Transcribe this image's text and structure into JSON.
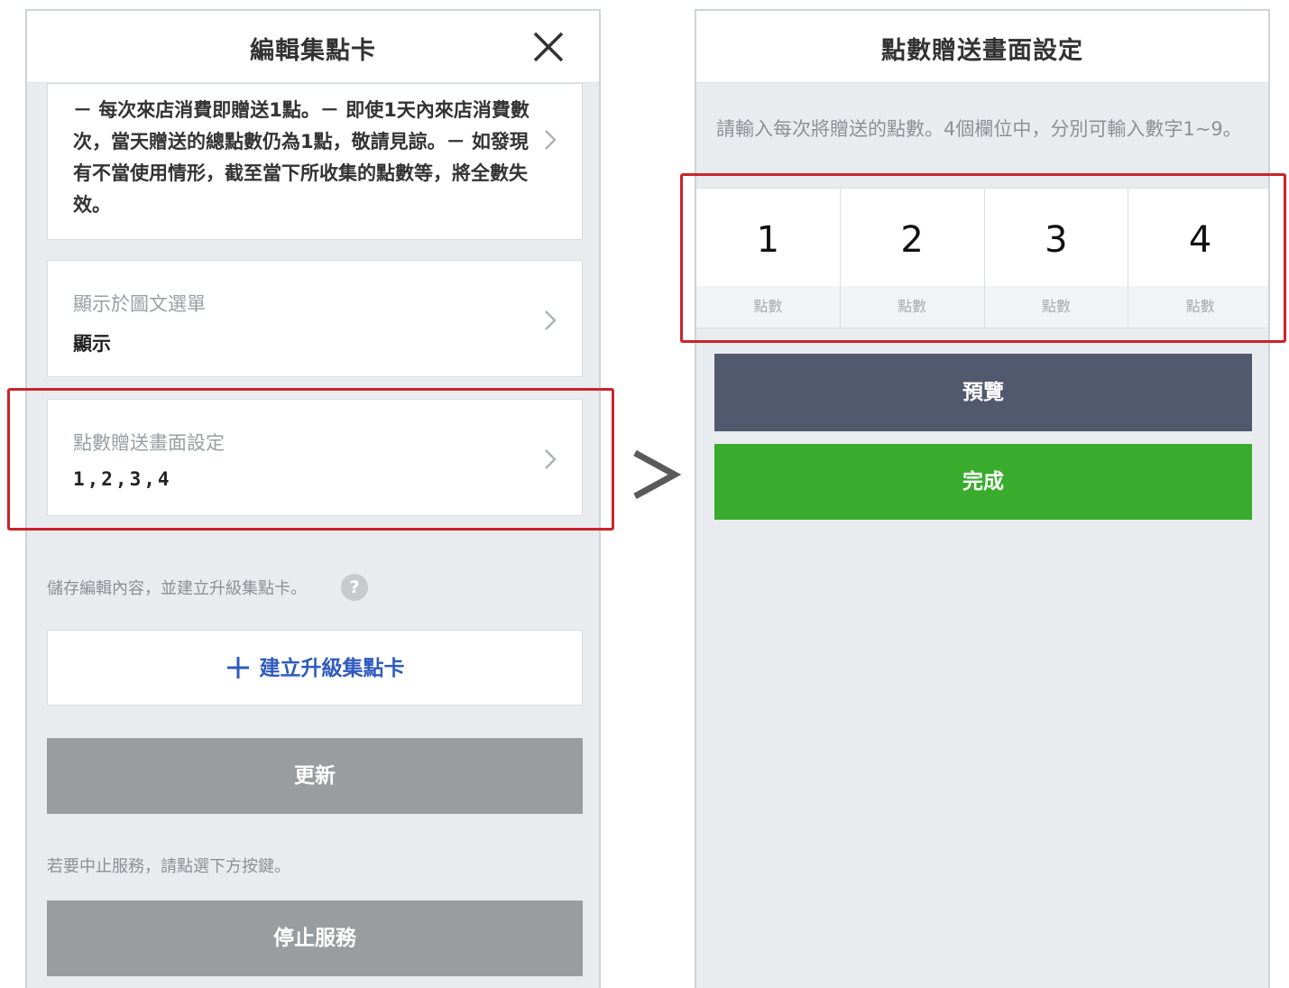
{
  "left": {
    "title": "編輯集點卡",
    "rules_text": "－ 每次來店消費即贈送1點。－ 即使1天內來店消費數次，當天贈送的總點數仍為1點，敬請見諒。－ 如發現有不當使用情形，截至當下所收集的點數等，將全數失效。",
    "rich_menu": {
      "label": "顯示於圖文選單",
      "value": "顯示"
    },
    "points_setting": {
      "label": "點數贈送畫面設定",
      "value": "1,2,3,4"
    },
    "save_hint": "儲存編輯內容，並建立升級集點卡。",
    "help_icon_text": "?",
    "create_upgrade_label": "建立升級集點卡",
    "update_label": "更新",
    "stop_hint": "若要中止服務，請點選下方按鍵。",
    "stop_label": "停止服務"
  },
  "right": {
    "title": "點數贈送畫面設定",
    "instruction": "請輸入每次將贈送的點數。4個欄位中，分別可輸入數字1~9。",
    "points": [
      {
        "value": "1",
        "unit": "點數"
      },
      {
        "value": "2",
        "unit": "點數"
      },
      {
        "value": "3",
        "unit": "點數"
      },
      {
        "value": "4",
        "unit": "點數"
      }
    ],
    "preview_label": "預覽",
    "done_label": "完成"
  },
  "colors": {
    "highlight": "#c9242c",
    "primary_green": "#3aac2d",
    "dark_button": "#51596f",
    "link_blue": "#2f5bbd",
    "disabled_gray": "#9a9d9f"
  },
  "icons": [
    "close-icon",
    "chevron-right-icon",
    "help-icon",
    "plus-icon",
    "arrow-right-icon"
  ]
}
